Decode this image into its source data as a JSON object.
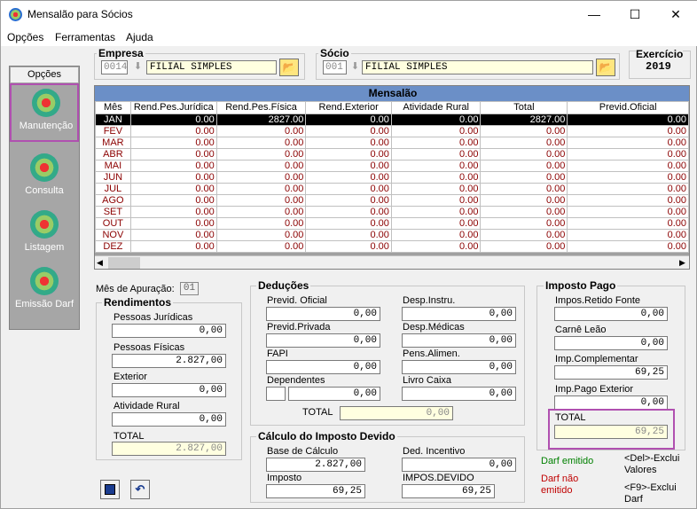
{
  "window": {
    "title": "Mensalão para Sócios",
    "minimize": "—",
    "maximize": "☐",
    "close": "✕"
  },
  "menu": {
    "opcoes": "Opções",
    "ferramentas": "Ferramentas",
    "ajuda": "Ajuda"
  },
  "sidebar": {
    "header": "Opções",
    "items": [
      {
        "label": "Manutenção",
        "icon": "globe-icon"
      },
      {
        "label": "Consulta",
        "icon": "globe-icon"
      },
      {
        "label": "Listagem",
        "icon": "globe-icon"
      },
      {
        "label": "Emissão Darf",
        "icon": "globe-icon"
      }
    ]
  },
  "empresa": {
    "label": "Empresa",
    "code": "0014",
    "name": "FILIAL SIMPLES"
  },
  "socio": {
    "label": "Sócio",
    "code": "001",
    "name": "FILIAL SIMPLES"
  },
  "exercicio": {
    "label": "Exercício",
    "year": "2019"
  },
  "grid": {
    "title": "Mensalão",
    "columns": [
      "Mês",
      "Rend.Pes.Jurídica",
      "Rend.Pes.Física",
      "Rend.Exterior",
      "Atividade Rural",
      "Total",
      "Previd.Oficial"
    ],
    "rows": [
      [
        "JAN",
        "0.00",
        "2827.00",
        "0.00",
        "0.00",
        "2827.00",
        "0.00"
      ],
      [
        "FEV",
        "0.00",
        "0.00",
        "0.00",
        "0.00",
        "0.00",
        "0.00"
      ],
      [
        "MAR",
        "0.00",
        "0.00",
        "0.00",
        "0.00",
        "0.00",
        "0.00"
      ],
      [
        "ABR",
        "0.00",
        "0.00",
        "0.00",
        "0.00",
        "0.00",
        "0.00"
      ],
      [
        "MAI",
        "0.00",
        "0.00",
        "0.00",
        "0.00",
        "0.00",
        "0.00"
      ],
      [
        "JUN",
        "0.00",
        "0.00",
        "0.00",
        "0.00",
        "0.00",
        "0.00"
      ],
      [
        "JUL",
        "0.00",
        "0.00",
        "0.00",
        "0.00",
        "0.00",
        "0.00"
      ],
      [
        "AGO",
        "0.00",
        "0.00",
        "0.00",
        "0.00",
        "0.00",
        "0.00"
      ],
      [
        "SET",
        "0.00",
        "0.00",
        "0.00",
        "0.00",
        "0.00",
        "0.00"
      ],
      [
        "OUT",
        "0.00",
        "0.00",
        "0.00",
        "0.00",
        "0.00",
        "0.00"
      ],
      [
        "NOV",
        "0.00",
        "0.00",
        "0.00",
        "0.00",
        "0.00",
        "0.00"
      ],
      [
        "DEZ",
        "0.00",
        "0.00",
        "0.00",
        "0.00",
        "0.00",
        "0.00"
      ]
    ]
  },
  "apuracao": {
    "label": "Mês de Apuração:",
    "value": "01"
  },
  "rendimentos": {
    "title": "Rendimentos",
    "pj_label": "Pessoas Jurídicas",
    "pj": "0,00",
    "pf_label": "Pessoas Físicas",
    "pf": "2.827,00",
    "ext_label": "Exterior",
    "ext": "0,00",
    "rural_label": "Atividade Rural",
    "rural": "0,00",
    "total_label": "TOTAL",
    "total": "2.827,00"
  },
  "deducoes": {
    "title": "Deduções",
    "previd_oficial_label": "Previd. Oficial",
    "previd_oficial": "0,00",
    "previd_privada_label": "Previd.Privada",
    "previd_privada": "0,00",
    "fapi_label": "FAPI",
    "fapi": "0,00",
    "dependentes_label": "Dependentes",
    "dependentes_count": "",
    "dependentes": "0,00",
    "desp_instru_label": "Desp.Instru.",
    "desp_instru": "0,00",
    "desp_medicas_label": "Desp.Médicas",
    "desp_medicas": "0,00",
    "pens_alimen_label": "Pens.Alimen.",
    "pens_alimen": "0,00",
    "livro_caixa_label": "Livro Caixa",
    "livro_caixa": "0,00",
    "total_label": "TOTAL",
    "total": "0,00"
  },
  "calculo": {
    "title": "Cálculo do Imposto Devido",
    "base_label": "Base de Cálculo",
    "base": "2.827,00",
    "ded_incentivo_label": "Ded. Incentivo",
    "ded_incentivo": "0,00",
    "imposto_label": "Imposto",
    "imposto": "69,25",
    "impos_devido_label": "IMPOS.DEVIDO",
    "impos_devido": "69,25"
  },
  "imposto_pago": {
    "title": "Imposto Pago",
    "retido_label": "Impos.Retido  Fonte",
    "retido": "0,00",
    "carne_label": "Carnê Leão",
    "carne": "0,00",
    "complementar_label": "Imp.Complementar",
    "complementar": "69,25",
    "exterior_label": "Imp.Pago Exterior",
    "exterior": "0,00",
    "total_label": "TOTAL",
    "total": "69,25"
  },
  "legend": {
    "emitido": "Darf emitido",
    "nao_emitido": "Darf não emitido",
    "del_hint": "<Del>-Exclui Valores",
    "f9_hint": "<F9>-Exclui Darf",
    "emitido_color": "#008000",
    "nao_emitido_color": "#c00000"
  }
}
